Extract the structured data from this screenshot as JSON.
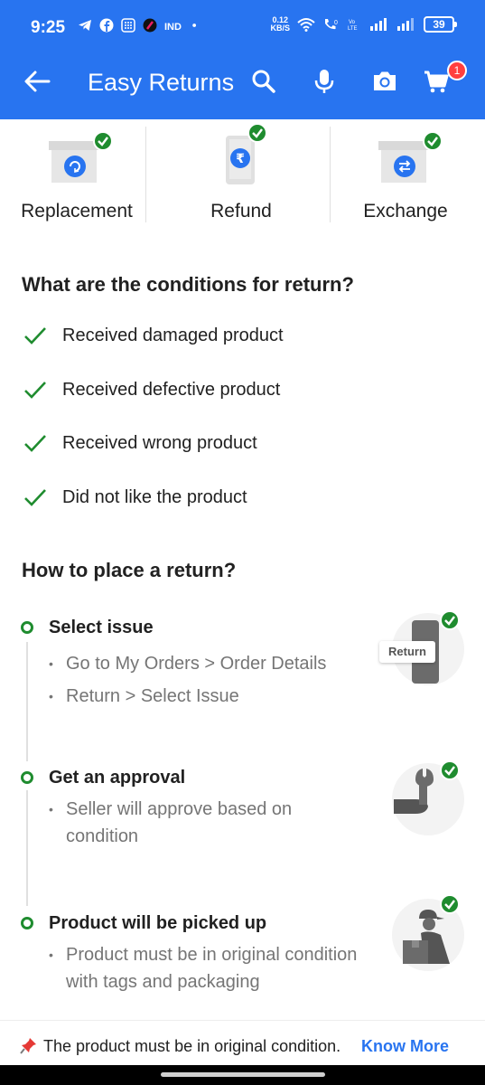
{
  "status_bar": {
    "time": "9:25",
    "net_speed_value": "0.12",
    "net_speed_unit": "KB/S",
    "battery": "39",
    "icons": [
      "telegram-icon",
      "facebook-icon",
      "grid-app-icon",
      "app-icon",
      "ind-app-icon",
      "dot-icon",
      "wifi-icon",
      "call-icon",
      "volte-icon",
      "signal-icon",
      "signal-icon-2"
    ]
  },
  "app_bar": {
    "title": "Easy Returns",
    "cart_count": "1",
    "accent_color": "#2874f0"
  },
  "return_types": [
    {
      "label": "Replacement",
      "icon": "replacement-icon"
    },
    {
      "label": "Refund",
      "icon": "refund-rupee-icon"
    },
    {
      "label": "Exchange",
      "icon": "exchange-icon"
    }
  ],
  "conditions": {
    "title": "What are the conditions for return?",
    "items": [
      "Received damaged product",
      "Received defective product",
      "Received wrong product",
      "Did not like the product"
    ]
  },
  "how_to": {
    "title": "How to place a return?",
    "steps": [
      {
        "title": "Select issue",
        "bullets": [
          "Go to My Orders > Order Details",
          "Return > Select Issue"
        ],
        "image_label": "Return"
      },
      {
        "title": "Get an approval",
        "bullets": [
          "Seller will approve based on condition"
        ]
      },
      {
        "title": "Product will be picked up",
        "bullets": [
          "Product must be in original condition with tags and packaging"
        ]
      }
    ]
  },
  "bottom_note": {
    "text": "The product must be in original condition.",
    "link": "Know More"
  },
  "colors": {
    "primary": "#2874f0",
    "success": "#1f8c2f",
    "badge": "#ff3f3f"
  }
}
